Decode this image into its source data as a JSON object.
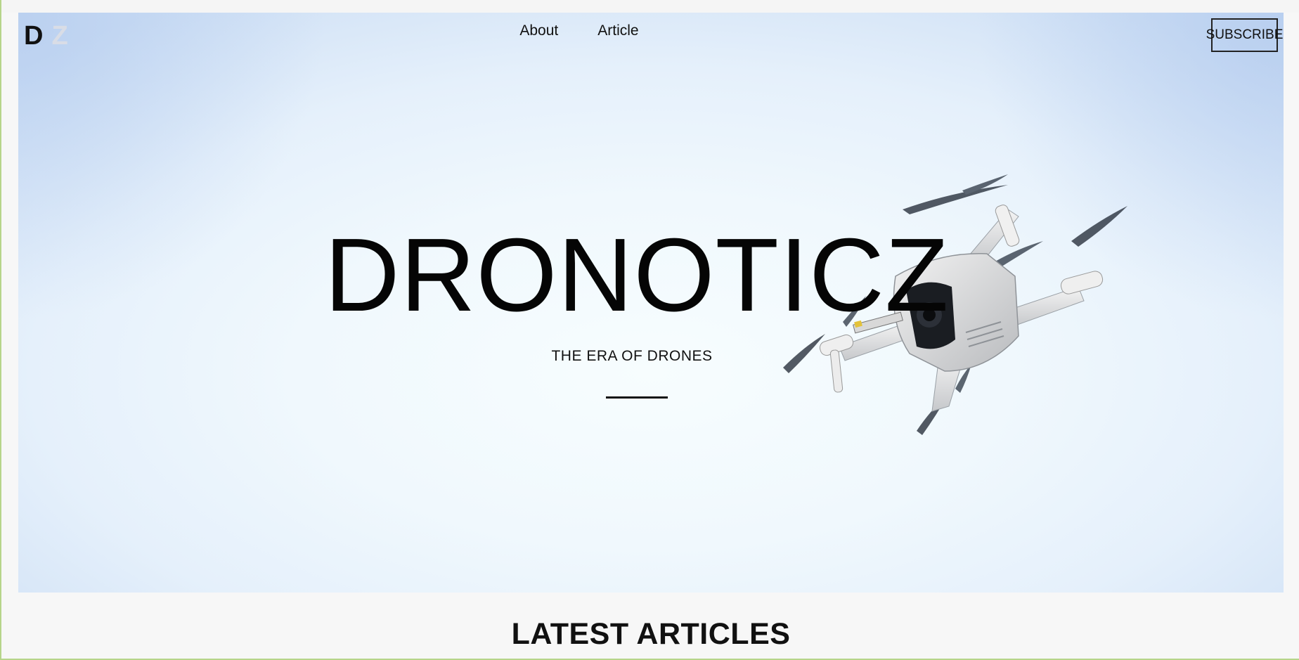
{
  "header": {
    "logo_first": "D",
    "logo_second": "Z",
    "nav": [
      {
        "label": "About"
      },
      {
        "label": "Article"
      }
    ],
    "subscribe_label": "SUBSCRIBE"
  },
  "hero": {
    "title": "DRONOTICZ",
    "subtitle": "THE ERA OF DRONES",
    "image_subject": "drone-photo"
  },
  "sections": {
    "latest_heading": "LATEST ARTICLES"
  },
  "colors": {
    "text": "#111111",
    "logo_accent": "#d9dde6",
    "sky_light": "#f7fdfe",
    "sky_edge": "#cfe0f5"
  }
}
